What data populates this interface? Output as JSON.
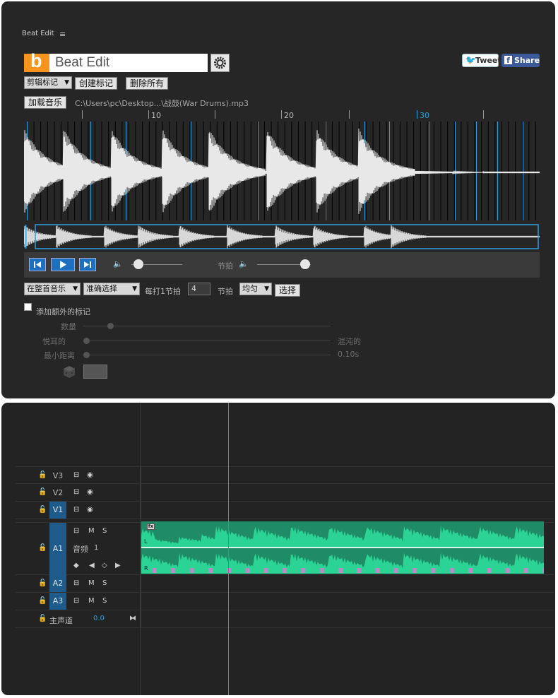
{
  "panel": {
    "title": "Beat Edit",
    "menu_glyph": "≡",
    "logo_letter": "b",
    "name_value": "Beat Edit",
    "settings_icon": "gear-icon",
    "tweet_label": "Tweet",
    "share_label": "Share",
    "marker_mode": "剪辑标记",
    "create_marker_label": "创建标记",
    "delete_all_label": "删除所有",
    "load_music_label": "加载音乐",
    "file_path": "C:\\Users\\pc\\Desktop...\\战鼓(War Drums).mp3",
    "ruler_labels": [
      "10",
      "20",
      "30"
    ],
    "volume_label": "节拍",
    "range_select": "在整首音乐",
    "precision_select": "准确选择",
    "every_label": "每打1节拍",
    "every_value": "4",
    "beat_label": "节拍",
    "distribution_select": "均匀",
    "select_label": "选择",
    "extra_markers_label": "添加额外的标记",
    "count_label": "数量",
    "pleasant_label": "悦耳的",
    "chaotic_label": "混沌的",
    "min_distance_label": "最小距离",
    "min_distance_value": "0.10s",
    "colors": {
      "accent": "#2d9fe0",
      "logo": "#f7941e",
      "twitter": "#55acee",
      "facebook": "#3b5998"
    }
  },
  "timeline": {
    "tracks": [
      {
        "name": "V3",
        "type": "video",
        "active": false
      },
      {
        "name": "V2",
        "type": "video",
        "active": false
      },
      {
        "name": "V1",
        "type": "video",
        "active": true
      },
      {
        "name": "A1",
        "type": "audio",
        "active": true,
        "label": "音频",
        "number": "1"
      },
      {
        "name": "A2",
        "type": "audio",
        "active": true
      },
      {
        "name": "A3",
        "type": "audio",
        "active": true
      }
    ],
    "master_label": "主声道",
    "master_value": "0.0",
    "audio_toggle_m": "M",
    "audio_toggle_s": "S",
    "clip_badge": "fx",
    "channel_left": "L",
    "channel_right": "R",
    "colors": {
      "clip": "#2bd395",
      "clip_dark": "#1f8c67",
      "marker": "#b58ec8",
      "playhead": "#2d8fd5"
    }
  }
}
